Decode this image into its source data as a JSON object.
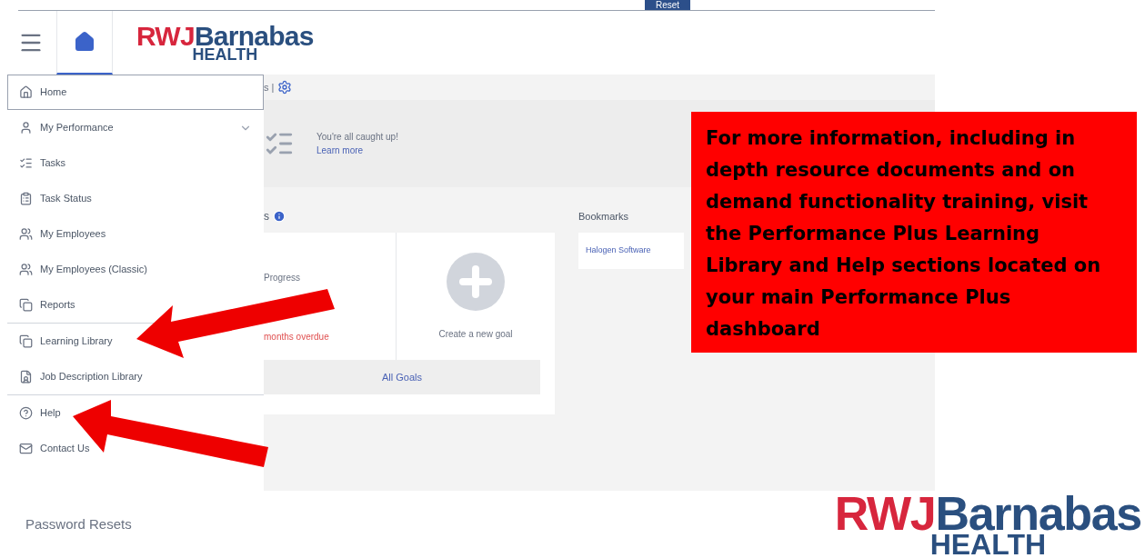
{
  "top_tab": {
    "label": "Reset"
  },
  "header": {
    "home_tab": {
      "selected": true
    },
    "logo": {
      "part_1": "RWJ",
      "part_2": "Barnabas",
      "part_3": "HEALTH"
    }
  },
  "sidebar": {
    "sections": [
      {
        "items": [
          {
            "label": "Home",
            "selected": true,
            "kind": "link"
          },
          {
            "label": "My Performance",
            "selected": false,
            "kind": "group"
          },
          {
            "label": "Tasks",
            "selected": false,
            "kind": "link"
          },
          {
            "label": "Task Status",
            "selected": false,
            "kind": "link"
          },
          {
            "label": "My Employees",
            "selected": false,
            "kind": "link"
          },
          {
            "label": "My Employees (Classic)",
            "selected": false,
            "kind": "link"
          },
          {
            "label": "Reports",
            "selected": false,
            "kind": "link"
          }
        ]
      },
      {
        "items": [
          {
            "label": "Learning Library",
            "selected": false,
            "kind": "link"
          },
          {
            "label": "Job Description Library",
            "selected": false,
            "kind": "link"
          }
        ]
      },
      {
        "items": [
          {
            "label": "Help",
            "selected": false,
            "kind": "link"
          },
          {
            "label": "Contact Us",
            "selected": false,
            "kind": "link"
          }
        ]
      }
    ]
  },
  "main": {
    "title_fragment": "s |",
    "banner": {
      "message": "You're all caught up!",
      "link": "Learn more"
    },
    "goals": {
      "heading_fragment": "s",
      "status_1": "Progress",
      "status_2": "months overdue",
      "create_label": "Create a new goal",
      "all_button": "All Goals"
    },
    "bookmarks": {
      "heading": "Bookmarks",
      "links": [
        "Halogen Software"
      ]
    }
  },
  "callout": {
    "text": "For more information, including in depth resource documents and on demand functionality training, visit the Performance Plus Learning Library and Help sections located on your main Performance Plus dashboard"
  },
  "footer": {
    "link": "Password Resets",
    "logo": {
      "part_1": "RWJ",
      "part_2": "Barnabas",
      "part_3": "HEALTH"
    }
  }
}
